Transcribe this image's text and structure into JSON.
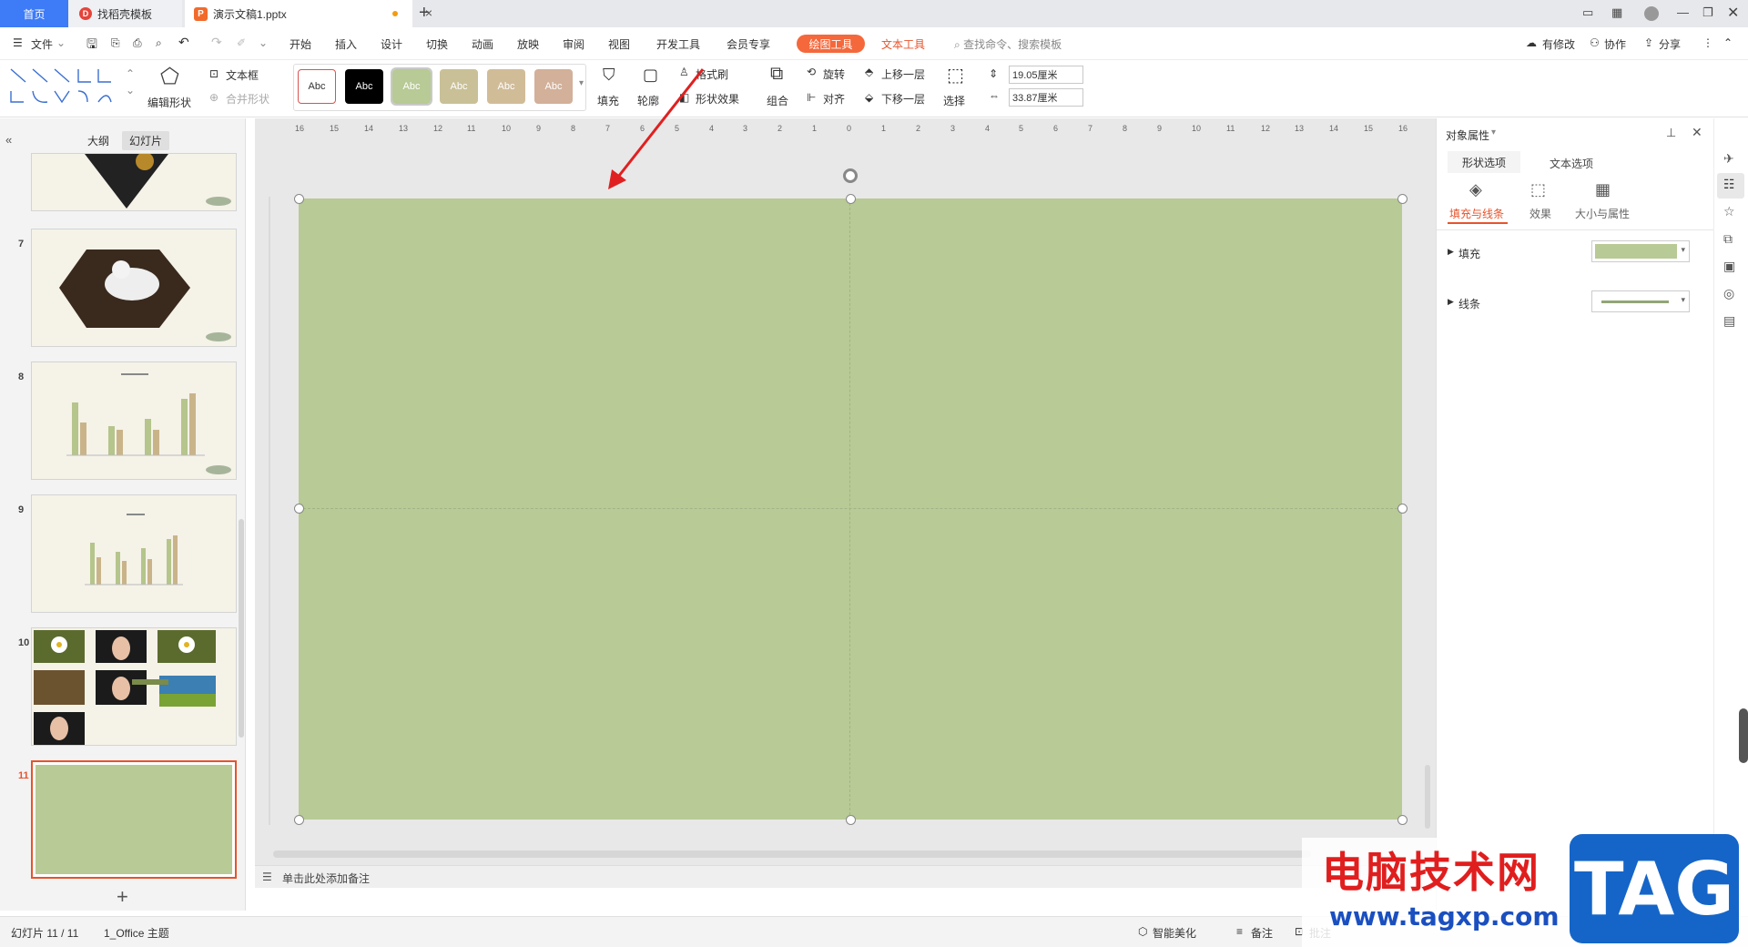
{
  "tabs": {
    "home": "首页",
    "template": "找稻壳模板",
    "document": "演示文稿1.pptx"
  },
  "menu": {
    "file": "文件",
    "items": [
      "开始",
      "插入",
      "设计",
      "切换",
      "动画",
      "放映",
      "审阅",
      "视图",
      "开发工具",
      "会员专享"
    ],
    "draw_tools": "绘图工具",
    "text_tools": "文本工具",
    "search_placeholder": "查找命令、搜索模板",
    "has_changes": "有修改",
    "collaborate": "协作",
    "share": "分享"
  },
  "ribbon": {
    "edit_shape": "编辑形状",
    "textbox": "文本框",
    "merge_shape": "合并形状",
    "style_sample": "Abc",
    "fill": "填充",
    "outline": "轮廓",
    "format_painter": "格式刷",
    "shape_effect": "形状效果",
    "group": "组合",
    "rotate": "旋转",
    "align": "对齐",
    "bring_forward": "上移一层",
    "send_backward": "下移一层",
    "select": "选择",
    "height": "19.05厘米",
    "width": "33.87厘米"
  },
  "left_panel": {
    "outline_tab": "大纲",
    "slides_tab": "幻灯片",
    "slide_numbers": [
      "7",
      "8",
      "9",
      "10",
      "11"
    ]
  },
  "canvas": {
    "notes_placeholder": "单击此处添加备注"
  },
  "ruler": {
    "top_labels": [
      "16",
      "15",
      "14",
      "13",
      "12",
      "11",
      "10",
      "9",
      "8",
      "7",
      "6",
      "5",
      "4",
      "3",
      "2",
      "1",
      "0",
      "1",
      "2",
      "3",
      "4",
      "5",
      "6",
      "7",
      "8",
      "9",
      "10",
      "11",
      "12",
      "13",
      "14",
      "15",
      "16"
    ]
  },
  "right_panel": {
    "title": "对象属性",
    "tab_shape": "形状选项",
    "tab_text": "文本选项",
    "sub_fill_line": "填充与线条",
    "sub_effect": "效果",
    "sub_size": "大小与属性",
    "fill_label": "填充",
    "line_label": "线条"
  },
  "status": {
    "slide_counter": "幻灯片 11 / 11",
    "theme": "1_Office 主题",
    "beautify": "智能美化",
    "notes": "备注",
    "comments": "批注"
  },
  "watermark": {
    "text": "电脑技术网",
    "url": "www.tagxp.com",
    "logo": "TAG"
  },
  "colors": {
    "slide_fill": "#b8ca95",
    "accent": "#f4683b",
    "tab_active": "#3d7bf7"
  }
}
